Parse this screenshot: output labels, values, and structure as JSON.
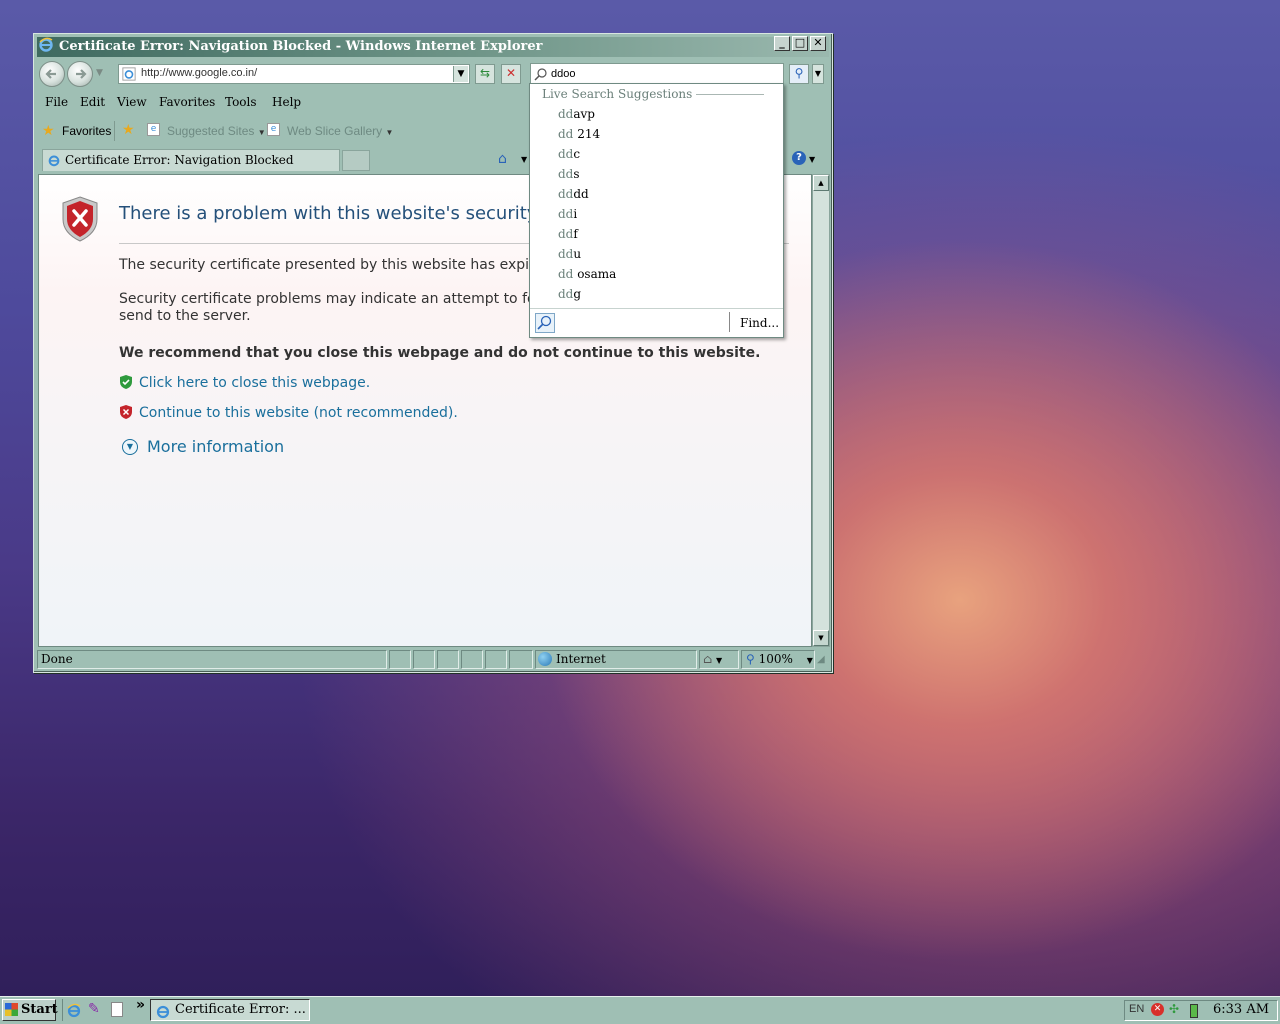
{
  "window": {
    "title": "Certificate Error: Navigation Blocked - Windows Internet Explorer",
    "minimize": "_",
    "maximize": "□",
    "close": "✕"
  },
  "nav": {
    "back_icon": "back-arrow-icon",
    "forward_icon": "forward-arrow-icon",
    "address": "http://www.google.co.in/",
    "search_value": "ddoo"
  },
  "menu": [
    "File",
    "Edit",
    "View",
    "Favorites",
    "Tools",
    "Help"
  ],
  "favorites_bar": {
    "favorites": "Favorites",
    "suggested_sites": "Suggested Sites",
    "web_slice_gallery": "Web Slice Gallery"
  },
  "tab": {
    "label": "Certificate Error: Navigation Blocked"
  },
  "content": {
    "title": "There is a problem with this website's security certificate.",
    "line1": "The security certificate presented by this website has expired or is not yet valid.",
    "line2a": "Security certificate problems may indicate an attempt to fool you or intercept any data you",
    "line2b": "send to the server.",
    "recommend": "We recommend that you close this webpage and do not continue to this website.",
    "close_link": "Click here to close this webpage.",
    "continue_link": "Continue to this website (not recommended).",
    "more_info": "More information"
  },
  "suggestions": {
    "header": "Live Search Suggestions",
    "items": [
      {
        "pre": "dd",
        "rest": "avp"
      },
      {
        "pre": "dd",
        "rest": " 214"
      },
      {
        "pre": "dd",
        "rest": "c"
      },
      {
        "pre": "dd",
        "rest": "s"
      },
      {
        "pre": "dd",
        "rest": "dd"
      },
      {
        "pre": "dd",
        "rest": "i"
      },
      {
        "pre": "dd",
        "rest": "f"
      },
      {
        "pre": "dd",
        "rest": "u"
      },
      {
        "pre": "dd",
        "rest": " osama"
      },
      {
        "pre": "dd",
        "rest": "g"
      }
    ],
    "find": "Find..."
  },
  "status": {
    "text": "Done",
    "zone": "Internet",
    "zoom": "100%"
  },
  "taskbar": {
    "start": "Start",
    "task": "Certificate Error: ...",
    "more": "»",
    "lang": "EN",
    "clock": "6:33 AM"
  },
  "colors": {
    "chrome": "#9fbfb4",
    "title_text": "#24507a",
    "link": "#1a6f9c"
  }
}
